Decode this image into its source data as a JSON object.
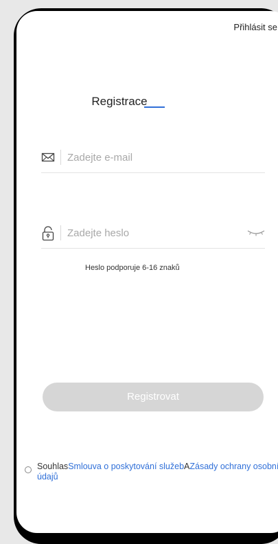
{
  "header": {
    "login_link": "Přihlásit se"
  },
  "title": "Registrace",
  "email": {
    "placeholder": "Zadejte e-mail",
    "value": ""
  },
  "password": {
    "placeholder": "Zadejte heslo",
    "value": ""
  },
  "hint": "Heslo podporuje 6-16 znaků",
  "register_button": "Registrovat",
  "agreement": {
    "prefix": "Souhlas",
    "terms_link": "Smlouva o poskytování služeb",
    "conjunction": "A",
    "privacy_link_part1": "Zásady",
    "privacy_link_part2": "ochrany osobních údajů"
  },
  "colors": {
    "accent": "#2f6fd8",
    "button_disabled": "#d6d6d6",
    "frame": "#e8e8e8"
  },
  "icons": {
    "email": "envelope-icon",
    "password": "padlock-icon",
    "visibility": "eye-closed-icon"
  }
}
